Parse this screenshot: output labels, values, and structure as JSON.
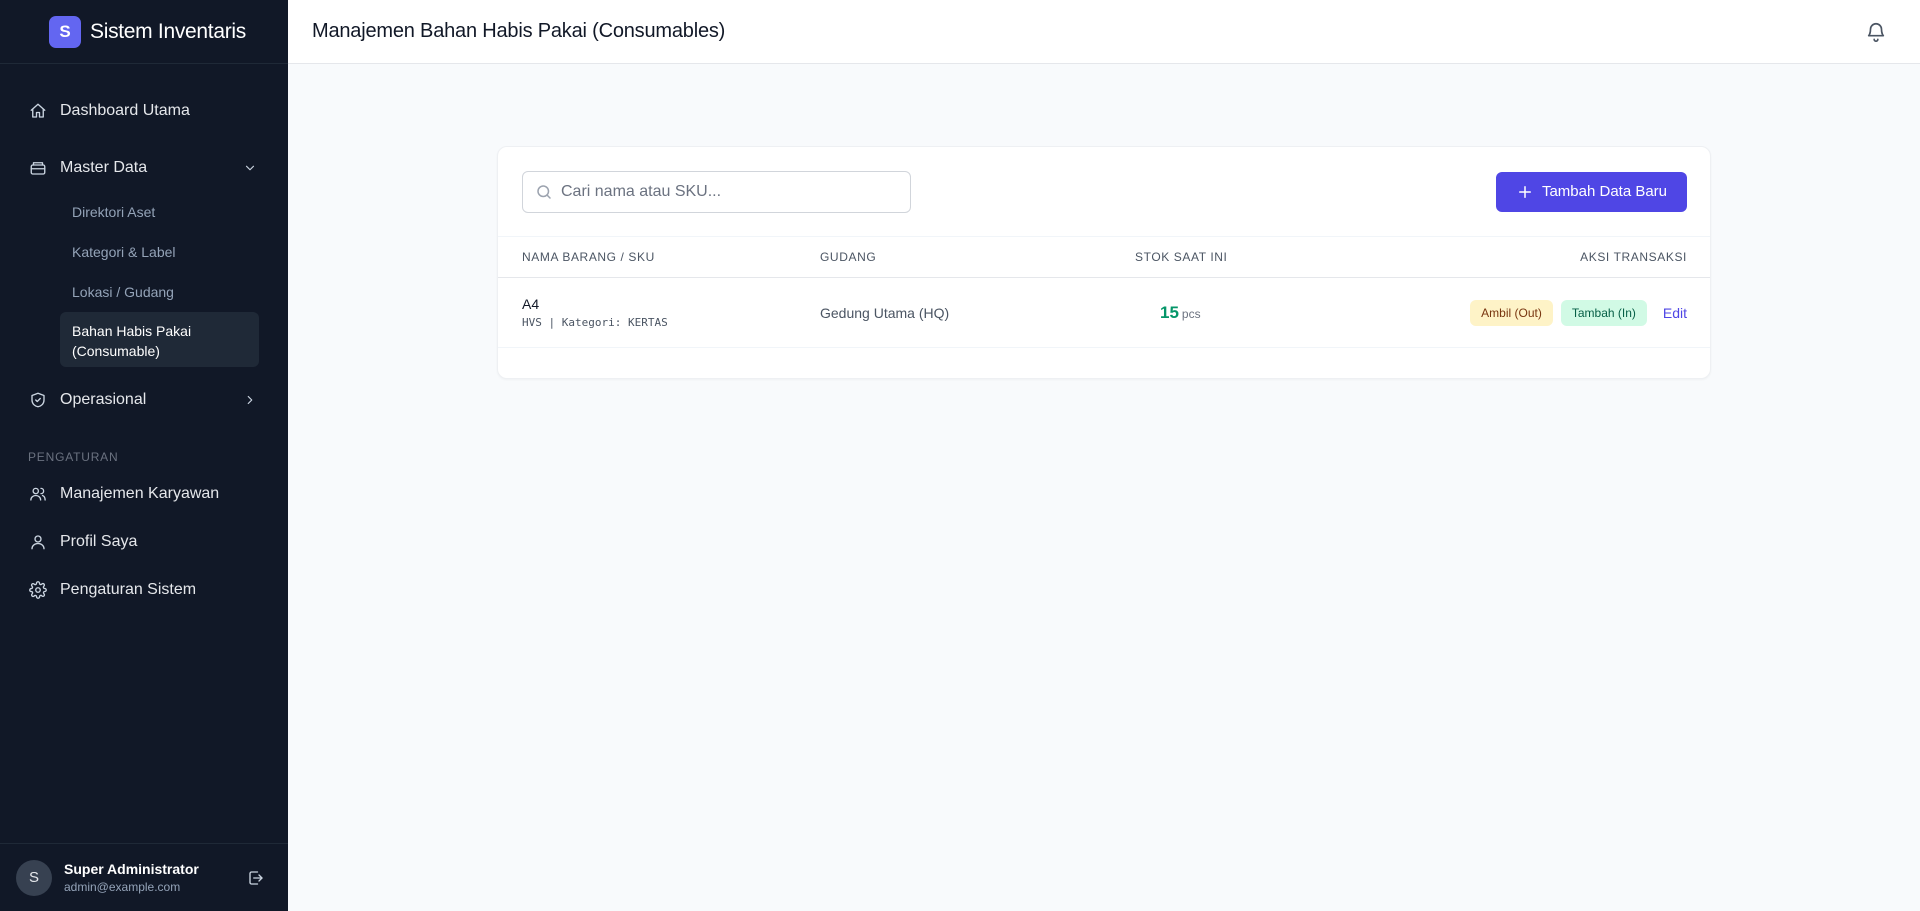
{
  "brand": {
    "logo_letter": "S",
    "name": "Sistem Inventaris",
    "accent": "#6366f1"
  },
  "sidebar": {
    "items": [
      {
        "label": "Dashboard Utama",
        "icon": "home-icon"
      },
      {
        "label": "Master Data",
        "icon": "archive-icon",
        "expanded": true,
        "children": [
          {
            "label": "Direktori Aset"
          },
          {
            "label": "Kategori & Label"
          },
          {
            "label": "Lokasi / Gudang"
          },
          {
            "label": "Bahan Habis Pakai (Consumable)",
            "active": true
          }
        ]
      },
      {
        "label": "Operasional",
        "icon": "shield-check-icon",
        "expanded": false
      }
    ],
    "section_label": "PENGATURAN",
    "settings_items": [
      {
        "label": "Manajemen Karyawan",
        "icon": "users-icon"
      },
      {
        "label": "Profil Saya",
        "icon": "user-icon"
      },
      {
        "label": "Pengaturan Sistem",
        "icon": "gear-icon"
      }
    ]
  },
  "user": {
    "avatar_letter": "S",
    "name": "Super Administrator",
    "email": "admin@example.com"
  },
  "header": {
    "title": "Manajemen Bahan Habis Pakai (Consumables)"
  },
  "toolbar": {
    "search_placeholder": "Cari nama atau SKU...",
    "add_label": "Tambah Data Baru"
  },
  "table": {
    "columns": [
      "NAMA BARANG / SKU",
      "GUDANG",
      "STOK SAAT INI",
      "AKSI TRANSAKSI"
    ],
    "rows": [
      {
        "name": "A4",
        "sku": "HVS | Kategori: KERTAS",
        "gudang": "Gedung Utama (HQ)",
        "stok": "15",
        "unit": "pcs",
        "action_out": "Ambil (Out)",
        "action_in": "Tambah (In)",
        "action_edit": "Edit"
      }
    ]
  },
  "colors": {
    "primary": "#4f46e5",
    "sidebar_bg": "#111827",
    "stock_ok": "#059669"
  }
}
